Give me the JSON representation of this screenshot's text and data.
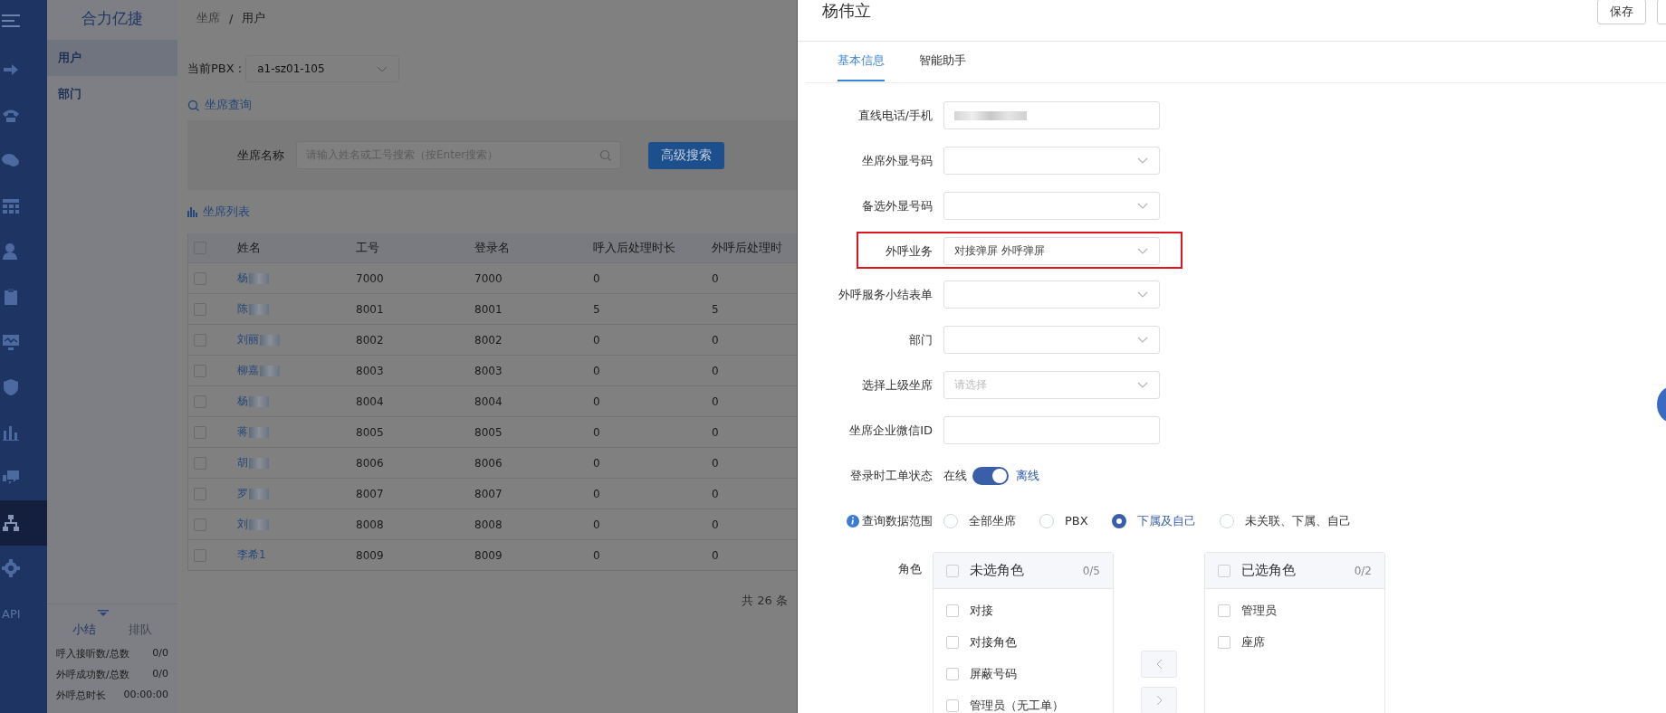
{
  "nav": {
    "items": [
      {
        "selected": false
      },
      {
        "selected": false
      },
      {
        "selected": false
      },
      {
        "selected": false
      },
      {
        "selected": false
      },
      {
        "selected": false
      },
      {
        "selected": false
      },
      {
        "selected": false
      },
      {
        "selected": false
      },
      {
        "selected": false
      },
      {
        "selected": true
      },
      {
        "selected": false
      },
      {
        "label": "API",
        "selected": false
      }
    ]
  },
  "sidebar": {
    "title": "合力亿捷",
    "items": [
      {
        "label": "用户",
        "selected": true
      },
      {
        "label": "部门",
        "selected": false
      }
    ],
    "stats_tabs": [
      {
        "label": "小结",
        "selected": true
      },
      {
        "label": "排队",
        "selected": false
      }
    ],
    "stats": [
      {
        "label": "呼入接听数/总数",
        "value": "0/0"
      },
      {
        "label": "外呼成功数/总数",
        "value": "0/0"
      },
      {
        "label": "外呼总时长",
        "value": "00:00:00"
      }
    ]
  },
  "breadcrumb": {
    "items": [
      "坐席",
      "用户"
    ],
    "separator": "/"
  },
  "pbx": {
    "label": "当前PBX :",
    "value": "a1-sz01-105"
  },
  "query": {
    "title": "坐席查询",
    "field_label": "坐席名称",
    "placeholder": "请输入姓名或工号搜索（按Enter搜索）",
    "button": "高级搜索"
  },
  "table": {
    "title": "坐席列表",
    "header_checked": false,
    "columns": [
      "姓名",
      "工号",
      "登录名",
      "呼入后处理时长",
      "外呼后处理时"
    ],
    "rows": [
      {
        "cells": [
          "杨",
          "7000",
          "7000",
          "0",
          "0"
        ],
        "redacted": true,
        "checked": false
      },
      {
        "cells": [
          "陈",
          "8001",
          "8001",
          "5",
          "5"
        ],
        "redacted": true,
        "checked": false
      },
      {
        "cells": [
          "刘丽",
          "8002",
          "8002",
          "0",
          "0"
        ],
        "redacted": true,
        "checked": false
      },
      {
        "cells": [
          "柳嘉",
          "8003",
          "8003",
          "0",
          "0"
        ],
        "redacted": true,
        "checked": false
      },
      {
        "cells": [
          "杨",
          "8004",
          "8004",
          "0",
          "0"
        ],
        "redacted": true,
        "checked": false
      },
      {
        "cells": [
          "蒋",
          "8005",
          "8005",
          "0",
          "0"
        ],
        "redacted": true,
        "checked": false
      },
      {
        "cells": [
          "胡",
          "8006",
          "8006",
          "0",
          "0"
        ],
        "redacted": true,
        "checked": false
      },
      {
        "cells": [
          "罗",
          "8007",
          "8007",
          "0",
          "0"
        ],
        "redacted": true,
        "checked": false
      },
      {
        "cells": [
          "刘",
          "8008",
          "8008",
          "0",
          "0"
        ],
        "redacted": true,
        "checked": false
      },
      {
        "cells": [
          "李希1",
          "8009",
          "8009",
          "0",
          "0"
        ],
        "redacted": false,
        "checked": false
      }
    ],
    "total": "共 26 条"
  },
  "drawer": {
    "title": "杨伟立",
    "buttons": [
      "保存"
    ],
    "tabs": [
      {
        "label": "基本信息",
        "selected": true
      },
      {
        "label": "智能助手",
        "selected": false
      }
    ],
    "fields": [
      {
        "kind": "input",
        "label": "直线电话/手机",
        "redacted": true,
        "highlighted": false
      },
      {
        "kind": "select",
        "label": "坐席外显号码",
        "highlighted": false
      },
      {
        "kind": "select",
        "label": "备选外显号码",
        "highlighted": false
      },
      {
        "kind": "select",
        "label": "外呼业务",
        "value": "对接弹屏 外呼弹屏",
        "highlighted": true
      },
      {
        "kind": "select",
        "label": "外呼服务小结表单",
        "highlighted": false
      },
      {
        "kind": "select",
        "label": "部门",
        "highlighted": false
      },
      {
        "kind": "select",
        "label": "选择上级坐席",
        "placeholder": "请选择",
        "highlighted": false
      },
      {
        "kind": "input",
        "label": "坐席企业微信ID",
        "redacted": false,
        "highlighted": false
      },
      {
        "kind": "switch",
        "label": "登录时工单状态",
        "off_text": "在线",
        "on_text": "离线",
        "on": true,
        "highlighted": false
      },
      {
        "kind": "radio",
        "label": "查询数据范围",
        "info": true,
        "highlighted": false,
        "options": [
          {
            "label": "全部坐席",
            "selected": false
          },
          {
            "label": "PBX",
            "selected": false
          },
          {
            "label": "下属及自己",
            "selected": true
          },
          {
            "label": "未关联、下属、自己",
            "selected": false
          }
        ]
      },
      {
        "kind": "transfer",
        "label": "角色",
        "highlighted": false,
        "left": {
          "title": "未选角色",
          "count": "0/5",
          "checked": false,
          "items": [
            {
              "label": "对接",
              "checked": false
            },
            {
              "label": "对接角色",
              "checked": false
            },
            {
              "label": "屏蔽号码",
              "checked": false
            },
            {
              "label": "管理员（无工单）",
              "checked": false
            }
          ]
        },
        "right": {
          "title": "已选角色",
          "count": "0/2",
          "checked": false,
          "items": [
            {
              "label": "管理员",
              "checked": false
            },
            {
              "label": "座席",
              "checked": false
            }
          ]
        }
      }
    ]
  }
}
